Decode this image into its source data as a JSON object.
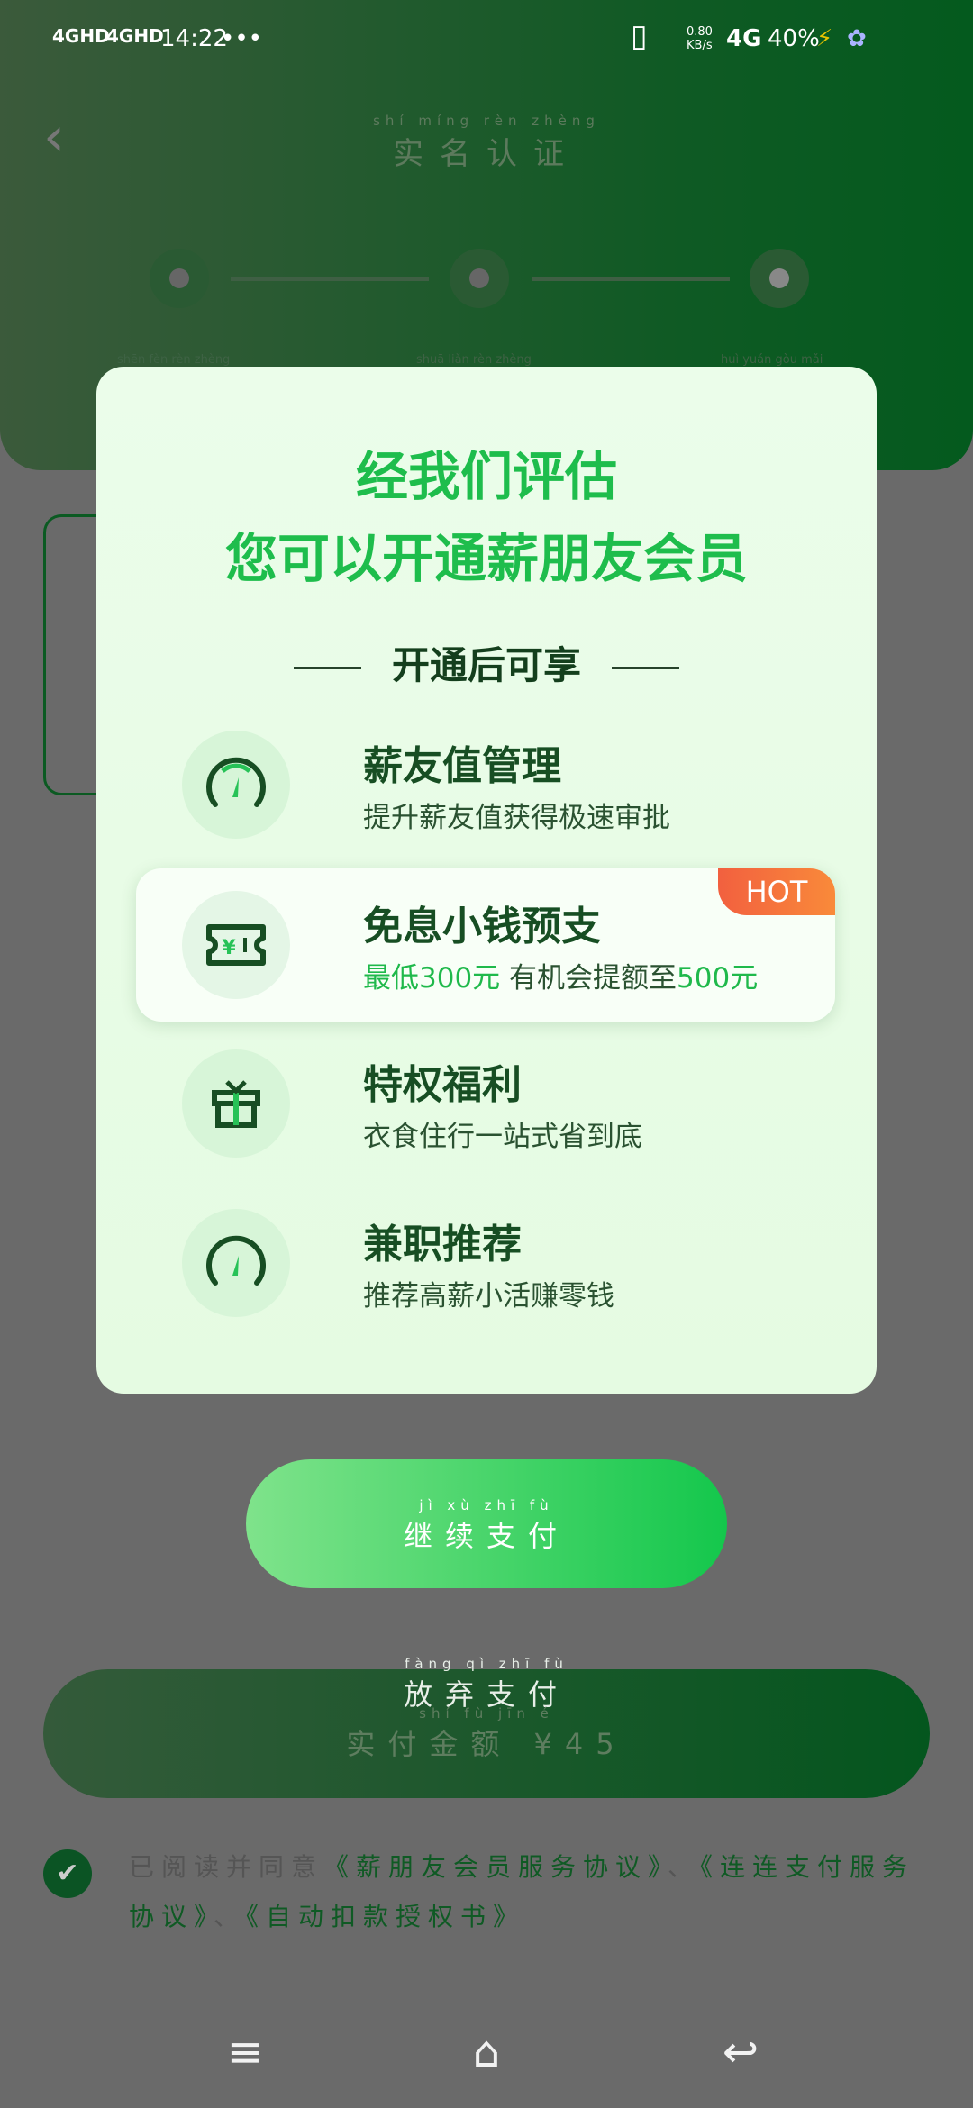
{
  "status": {
    "net1": "4GHD",
    "net2": "4GHD",
    "time": "14:22",
    "dots": "•••",
    "speed": "0.80 KB/s",
    "net3": "4G",
    "battery": "40%"
  },
  "header": {
    "title_py": "shí míng rèn zhèng",
    "title": "实名认证",
    "steps": [
      "shēn fèn rèn zhèng",
      "shuā liǎn rèn zhèng",
      "huì yuán gòu mǎi"
    ]
  },
  "modal": {
    "title1": "经我们评估",
    "title2": "您可以开通薪朋友会员",
    "subtitle": "开通后可享",
    "items": [
      {
        "icon": "gauge-icon",
        "title": "薪友值管理",
        "desc": "提升薪友值获得极速审批"
      },
      {
        "icon": "yuan-ticket-icon",
        "title": "免息小钱预支",
        "desc_a": "最低300元",
        "desc_b": " 有机会提额至",
        "desc_c": "500元",
        "badge": "HOT"
      },
      {
        "icon": "gift-icon",
        "title": "特权福利",
        "desc": "衣食住行一站式省到底"
      },
      {
        "icon": "gauge-icon",
        "title": "兼职推荐",
        "desc": "推荐高薪小活赚零钱"
      }
    ]
  },
  "continue": {
    "py": "jì xù zhī fù",
    "label": "继续支付"
  },
  "abandon": {
    "py": "fàng qì zhī fù",
    "label": "放弃支付",
    "amount_py": "shí fù jīn é",
    "amount": "实付金额 ¥45"
  },
  "agreement": {
    "checked": true,
    "prefix": "已阅读并同意",
    "link1": "《薪朋友会员服务协议》",
    "sep": "、",
    "link2": "《连连支付服务协议》",
    "link3": "《自动扣款授权书》"
  },
  "colors": {
    "accent": "#1ebd4c",
    "dark_green": "#0b5424",
    "hot": "#f2603f"
  }
}
